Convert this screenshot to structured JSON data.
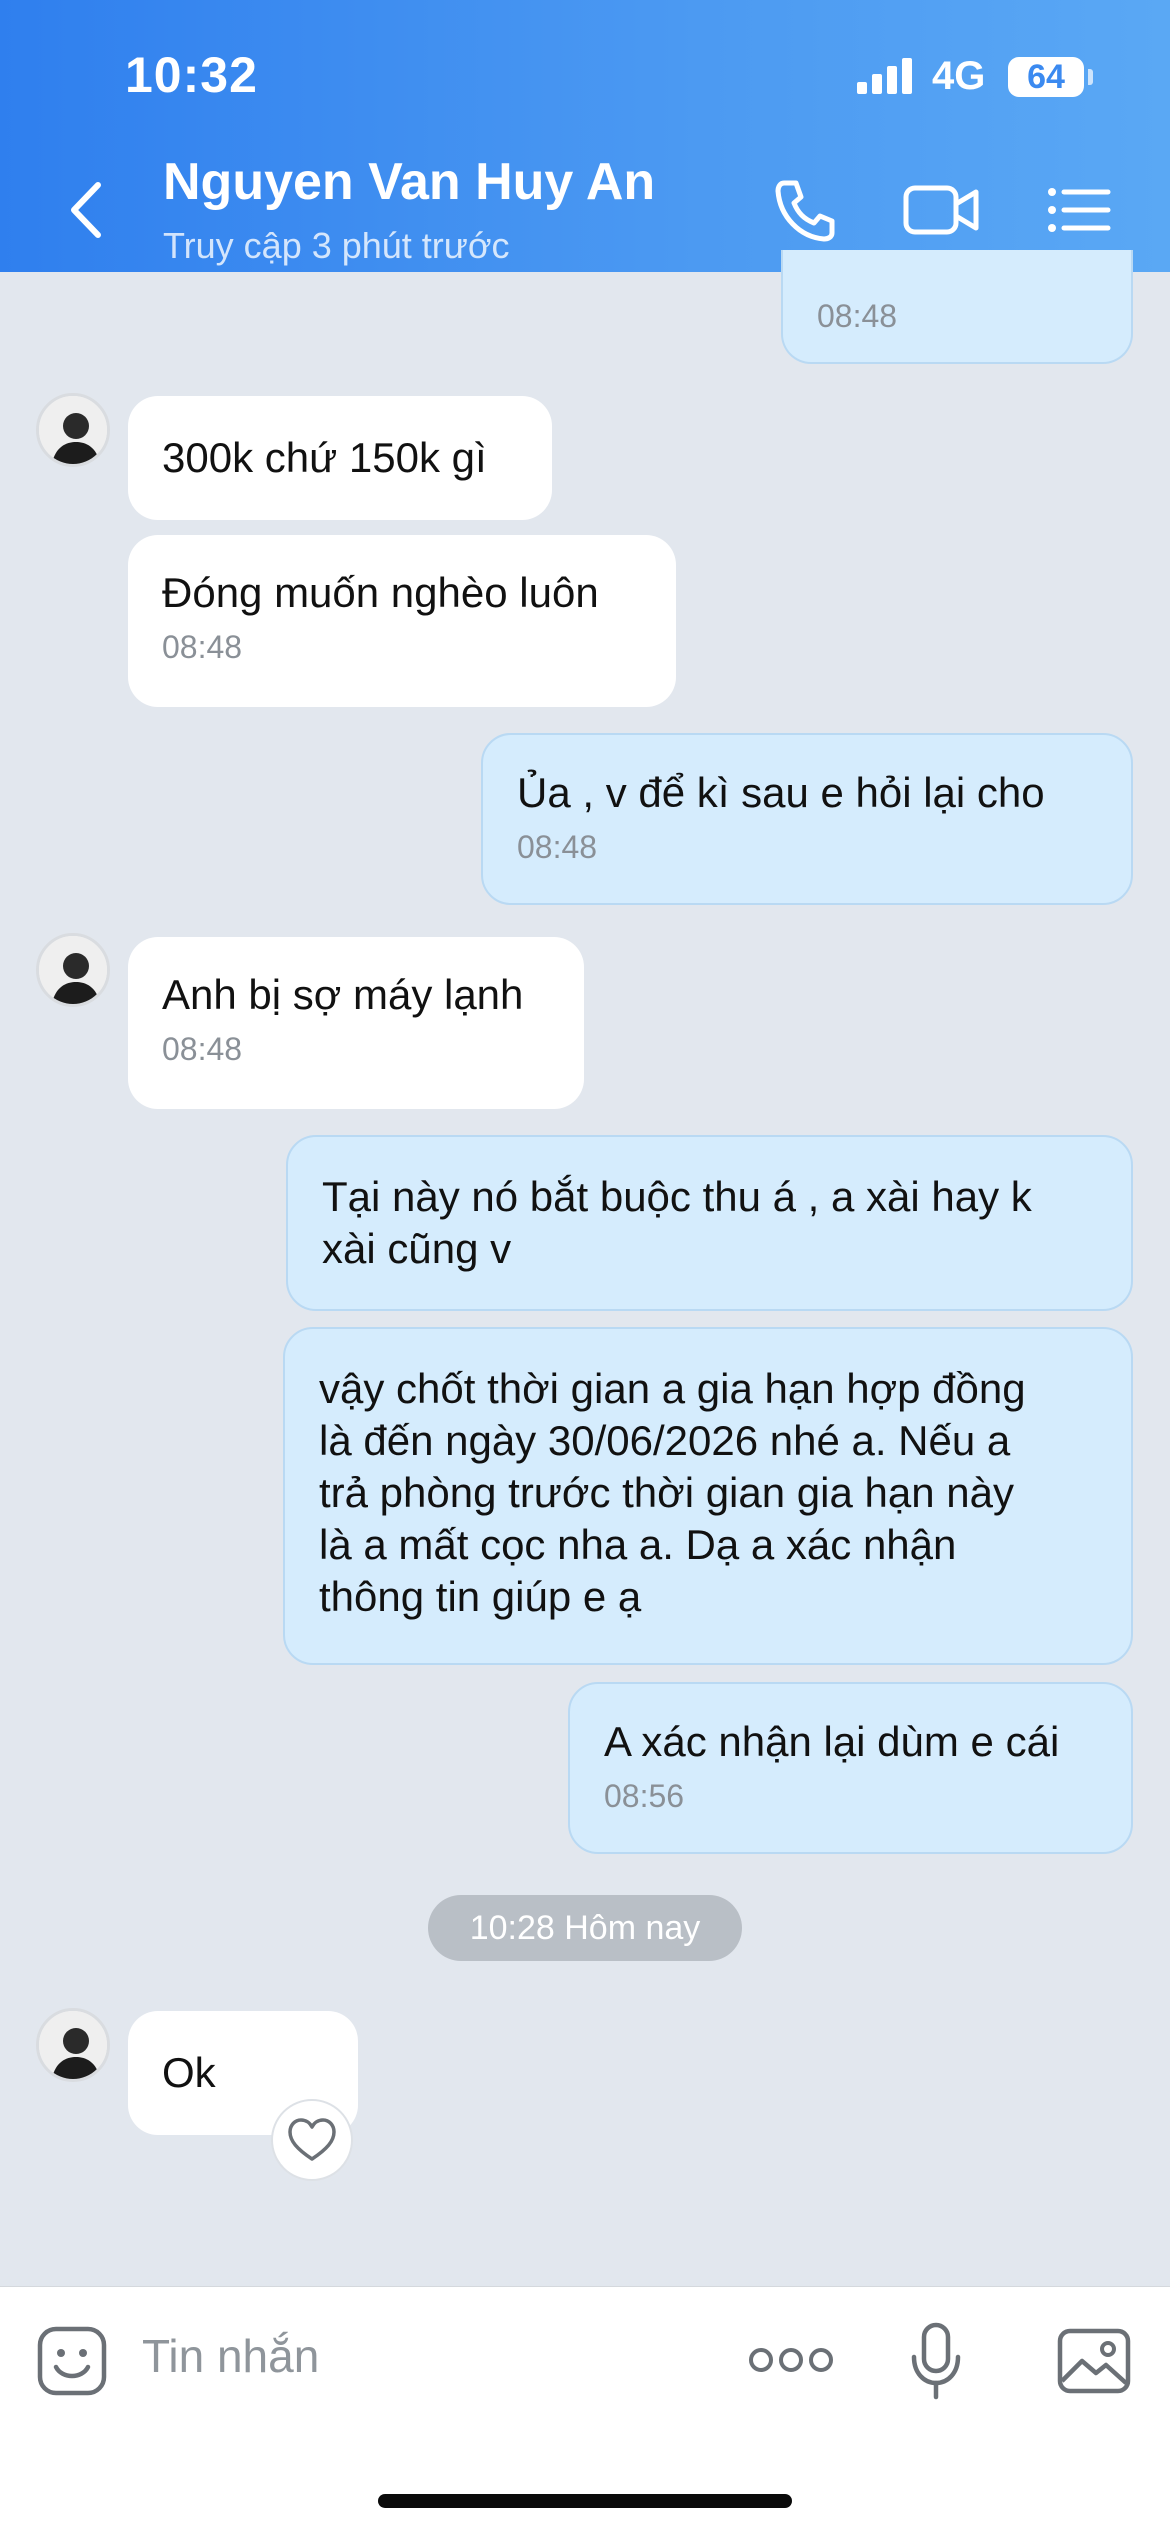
{
  "status_bar": {
    "time": "10:32",
    "network": "4G",
    "battery": "64"
  },
  "header": {
    "contact_name": "Nguyen Van Huy An",
    "contact_status": "Truy cập 3 phút trước",
    "icons": [
      "back-icon",
      "phone-icon",
      "video-icon",
      "menu-list-icon"
    ]
  },
  "messages": [
    {
      "direction": "out",
      "text": "",
      "time": "08:48"
    },
    {
      "direction": "in",
      "text": "300k chứ 150k gì",
      "time": ""
    },
    {
      "direction": "in",
      "text": "Đóng muốn nghèo luôn",
      "time": "08:48"
    },
    {
      "direction": "out",
      "text": "Ủa , v để kì sau e hỏi lại cho",
      "time": "08:48"
    },
    {
      "direction": "in",
      "text": "Anh bị sợ máy lạnh",
      "time": "08:48"
    },
    {
      "direction": "out",
      "text_lines": [
        "Tại này nó bắt buộc thu á , a xài hay k",
        "xài cũng v"
      ]
    },
    {
      "direction": "out",
      "text_lines": [
        "vậy chốt thời gian a gia hạn hợp đồng",
        "là đến ngày 30/06/2026 nhé a. Nếu a",
        "trả phòng trước thời gian gia hạn này",
        "là a mất cọc nha a. Dạ a xác nhận",
        "thông tin giúp e ạ"
      ]
    },
    {
      "direction": "out",
      "text": "A xác nhận lại dùm e cái",
      "time": "08:56"
    },
    {
      "direction": "in",
      "text": "Ok",
      "time": ""
    }
  ],
  "date_divider": "10:28 Hôm nay",
  "input_bar": {
    "placeholder": "Tin nhắn",
    "icons": [
      "sticker-icon",
      "more-icon",
      "microphone-icon",
      "image-icon"
    ]
  },
  "colors": {
    "header_start": "#2f7fee",
    "header_end": "#5aa8f4",
    "chat_bg": "#e2e7ee",
    "incoming_bubble": "#ffffff",
    "outgoing_bubble": "#d5ecfd"
  }
}
